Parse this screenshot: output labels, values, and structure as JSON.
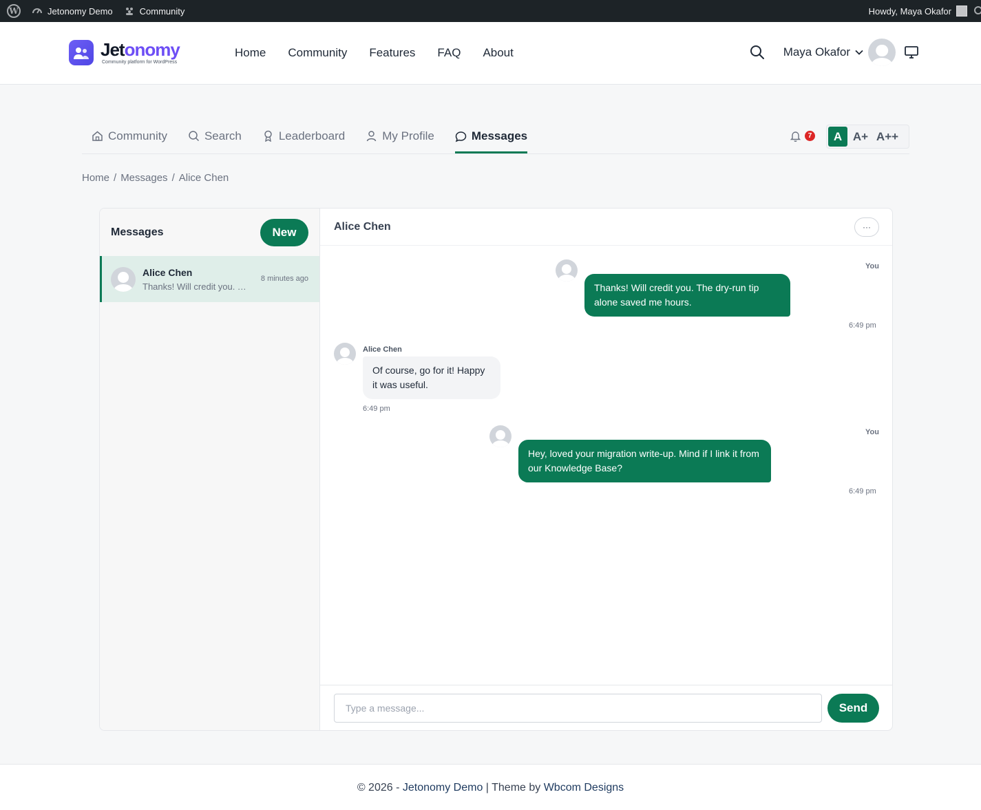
{
  "admin_bar": {
    "site_name": "Jetonomy Demo",
    "community_label": "Community",
    "howdy": "Howdy, Maya Okafor"
  },
  "header": {
    "logo_word_a": "Jet",
    "logo_word_b": "onomy",
    "logo_tagline": "Community platform for WordPress",
    "nav": [
      "Home",
      "Community",
      "Features",
      "FAQ",
      "About"
    ],
    "user_name": "Maya Okafor"
  },
  "subnav": {
    "items": [
      {
        "label": "Community",
        "icon": "home-icon"
      },
      {
        "label": "Search",
        "icon": "search-icon"
      },
      {
        "label": "Leaderboard",
        "icon": "award-icon"
      },
      {
        "label": "My Profile",
        "icon": "user-icon"
      },
      {
        "label": "Messages",
        "icon": "chat-icon",
        "active": true
      }
    ],
    "notification_count": "7",
    "font_sizes": [
      "A",
      "A+",
      "A++"
    ]
  },
  "breadcrumb": {
    "items": [
      "Home",
      "Messages",
      "Alice Chen"
    ],
    "separator": "/"
  },
  "sidebar": {
    "title": "Messages",
    "new_label": "New",
    "conversations": [
      {
        "name": "Alice Chen",
        "preview": "Thanks! Will credit you. The dry-run tip alone saved me hours.",
        "time": "8 minutes ago"
      }
    ]
  },
  "chat": {
    "title": "Alice Chen",
    "more_label": "···",
    "messages": [
      {
        "from": "You",
        "text": "Thanks! Will credit you. The dry-run tip alone saved me hours.",
        "time": "6:49 pm",
        "outgoing": true
      },
      {
        "from": "Alice Chen",
        "text": "Of course, go for it! Happy it was useful.",
        "time": "6:49 pm",
        "outgoing": false
      },
      {
        "from": "You",
        "text": "Hey, loved your migration write-up. Mind if I link it from our Knowledge Base?",
        "time": "6:49 pm",
        "outgoing": true
      }
    ],
    "input_placeholder": "Type a message...",
    "input_value": "",
    "send_label": "Send"
  },
  "footer": {
    "prefix": "© 2026 - ",
    "site": "Jetonomy Demo",
    "middle": " | Theme by ",
    "theme_author": "Wbcom Designs"
  },
  "colors": {
    "accent": "#0b7a55",
    "brand": "#6d4ef5",
    "badge": "#dc2626",
    "admin_bar": "#1d2327"
  }
}
